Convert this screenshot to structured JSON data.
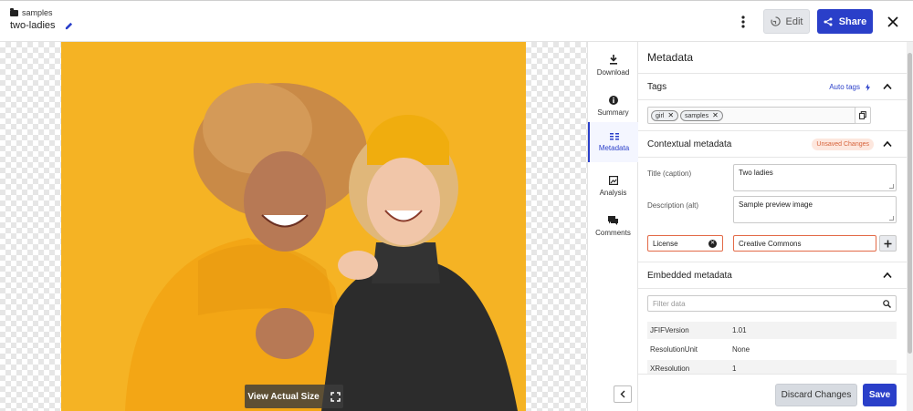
{
  "header": {
    "breadcrumb": "samples",
    "file_name": "two-ladies",
    "edit_label": "Edit",
    "share_label": "Share"
  },
  "viewer": {
    "view_actual_label": "View Actual Size"
  },
  "side_tabs": [
    {
      "label": "Download",
      "icon": "download-icon"
    },
    {
      "label": "Summary",
      "icon": "info-icon"
    },
    {
      "label": "Metadata",
      "icon": "metadata-icon",
      "active": true
    },
    {
      "label": "Analysis",
      "icon": "analysis-icon"
    },
    {
      "label": "Comments",
      "icon": "comments-icon"
    }
  ],
  "panel": {
    "title": "Metadata",
    "tags": {
      "label": "Tags",
      "auto_tags_label": "Auto tags",
      "chips": [
        "girl",
        "samples"
      ]
    },
    "contextual": {
      "label": "Contextual metadata",
      "unsaved_label": "Unsaved Changes",
      "title_label": "Title (caption)",
      "title_value": "Two ladies",
      "description_label": "Description (alt)",
      "description_value": "Sample preview image",
      "license_key": "License",
      "license_value": "Creative Commons"
    },
    "embedded": {
      "label": "Embedded metadata",
      "filter_placeholder": "Filter data",
      "rows": [
        {
          "key": "JFIFVersion",
          "value": "1.01"
        },
        {
          "key": "ResolutionUnit",
          "value": "None"
        },
        {
          "key": "XResolution",
          "value": "1"
        }
      ]
    },
    "discard_label": "Discard Changes",
    "save_label": "Save"
  },
  "colors": {
    "accent": "#2a3fc9",
    "warning": "#e36a47",
    "photo_background": "#f5b324"
  }
}
